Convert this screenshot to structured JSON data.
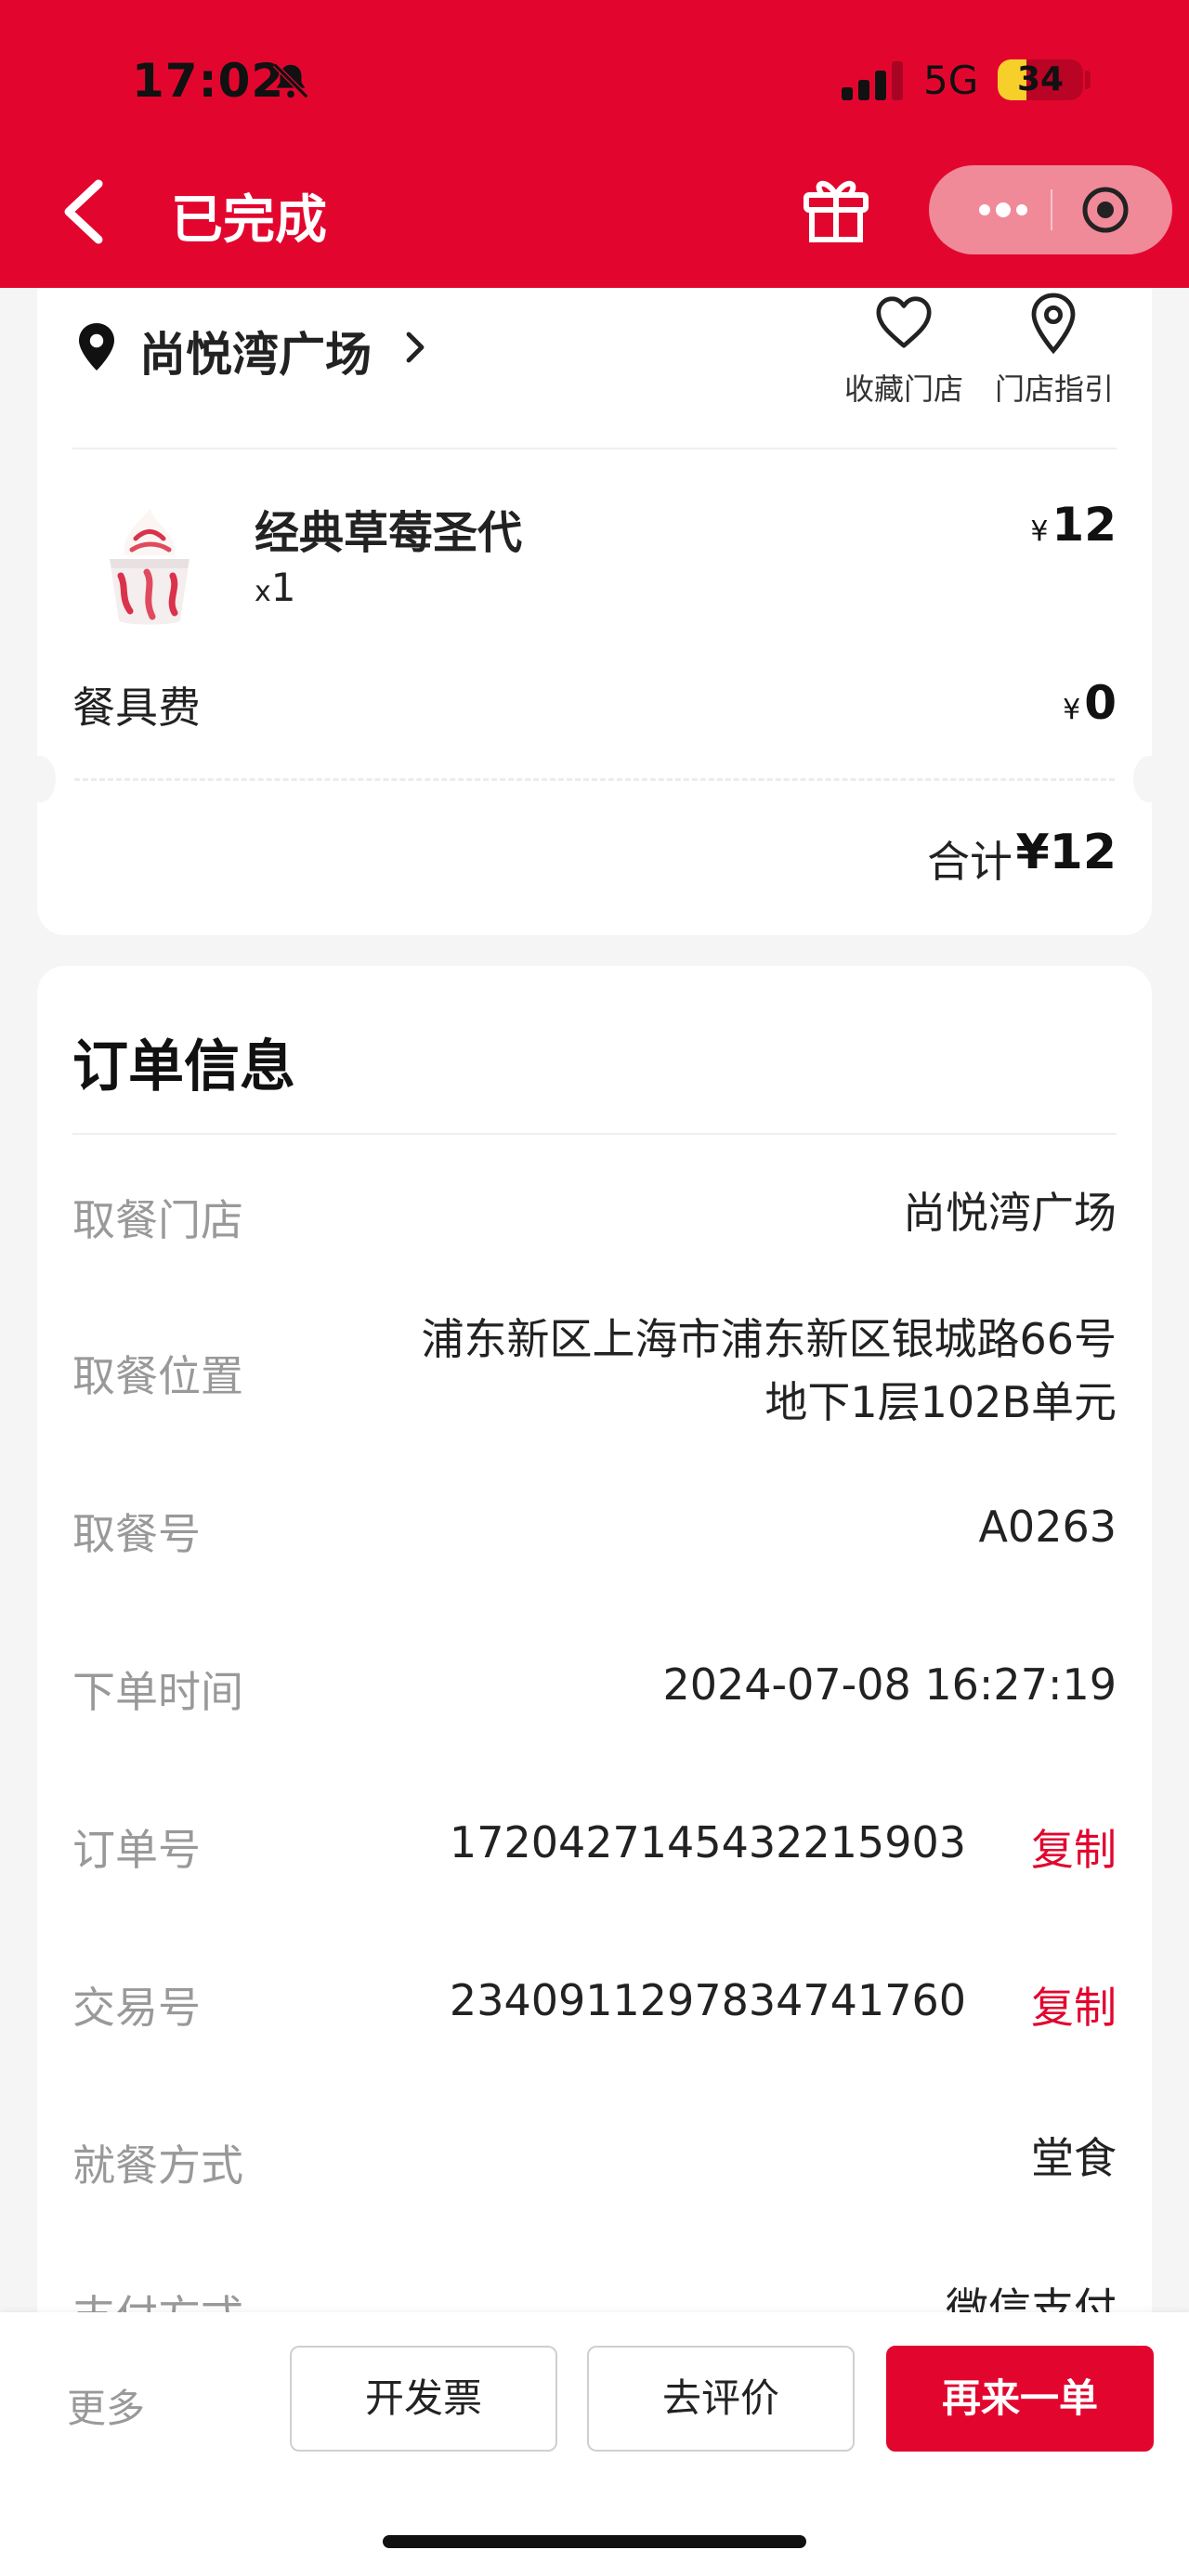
{
  "status_bar": {
    "time": "17:02",
    "network": "5G",
    "battery": "34",
    "battery_level": 0.34
  },
  "nav": {
    "title": "已完成"
  },
  "store": {
    "name": "尚悦湾广场",
    "favorite_label": "收藏门店",
    "guide_label": "门店指引"
  },
  "items": [
    {
      "name": "经典草莓圣代",
      "qty_prefix": "x",
      "qty": "1",
      "currency": "¥",
      "price": "12"
    }
  ],
  "fees": {
    "label": "餐具费",
    "currency": "¥",
    "amount": "0"
  },
  "total": {
    "label": "合计",
    "amount": "¥12"
  },
  "order_info": {
    "title": "订单信息",
    "rows": [
      {
        "label": "取餐门店",
        "value": "尚悦湾广场"
      },
      {
        "label": "取餐位置",
        "value_line1": "浦东新区上海市浦东新区银城路66号",
        "value_line2": "地下1层102B单元"
      },
      {
        "label": "取餐号",
        "value": "A0263"
      },
      {
        "label": "下单时间",
        "value": "2024-07-08 16:27:19"
      },
      {
        "label": "订单号",
        "value": "1720427145432215903",
        "action": "复制"
      },
      {
        "label": "交易号",
        "value": "2340911297834741760",
        "action": "复制"
      },
      {
        "label": "就餐方式",
        "value": "堂食"
      },
      {
        "label": "支付方式",
        "value": "微信支付"
      }
    ]
  },
  "bottom_bar": {
    "more": "更多",
    "invoice": "开发票",
    "review": "去评价",
    "reorder": "再来一单"
  },
  "colors": {
    "brand": "#e2062f",
    "capsule": "#f08a99",
    "label_gray": "#999999"
  }
}
